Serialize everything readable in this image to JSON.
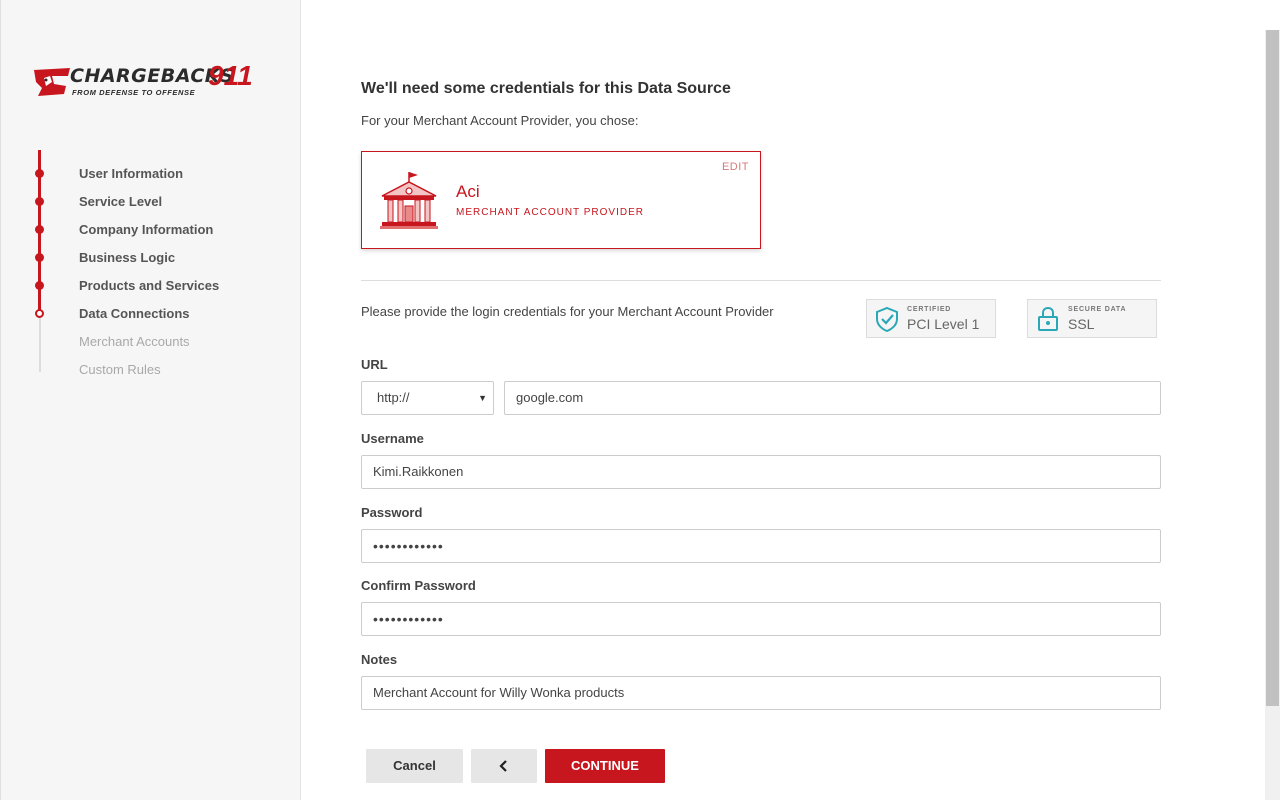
{
  "brand": {
    "logo_text": "CHARGEBACKS",
    "logo_number": "911",
    "tagline": "FROM DEFENSE TO OFFENSE",
    "accent_color": "#c7161d"
  },
  "sidebar": {
    "steps": [
      {
        "label": "User Information",
        "state": "done"
      },
      {
        "label": "Service Level",
        "state": "done"
      },
      {
        "label": "Company Information",
        "state": "done"
      },
      {
        "label": "Business Logic",
        "state": "done"
      },
      {
        "label": "Products and Services",
        "state": "done"
      },
      {
        "label": "Data Connections",
        "state": "current"
      },
      {
        "label": "Merchant Accounts",
        "state": "pending"
      },
      {
        "label": "Custom Rules",
        "state": "pending"
      }
    ]
  },
  "main": {
    "title": "We'll need some credentials for this Data Source",
    "subtitle": "For your Merchant Account Provider, you chose:",
    "provider": {
      "name": "Aci",
      "type": "MERCHANT ACCOUNT PROVIDER",
      "edit_label": "EDIT",
      "icon": "bank-building-icon"
    },
    "instructions": "Please provide the login credentials for your Merchant Account Provider",
    "badges": [
      {
        "small": "CERTIFIED",
        "big": "PCI Level 1",
        "icon": "shield-check-icon"
      },
      {
        "small": "SECURE DATA",
        "big": "SSL",
        "icon": "lock-icon"
      }
    ]
  },
  "form": {
    "url_label": "URL",
    "protocol": "http://",
    "url_value": "google.com",
    "username_label": "Username",
    "username_value": "Kimi.Raikkonen",
    "password_label": "Password",
    "password_value": "••••••••••••",
    "confirm_label": "Confirm Password",
    "confirm_value": "••••••••••••",
    "notes_label": "Notes",
    "notes_value": "Merchant Account for Willy Wonka products"
  },
  "actions": {
    "cancel": "Cancel",
    "back_icon": "chevron-left-icon",
    "continue": "CONTINUE"
  }
}
